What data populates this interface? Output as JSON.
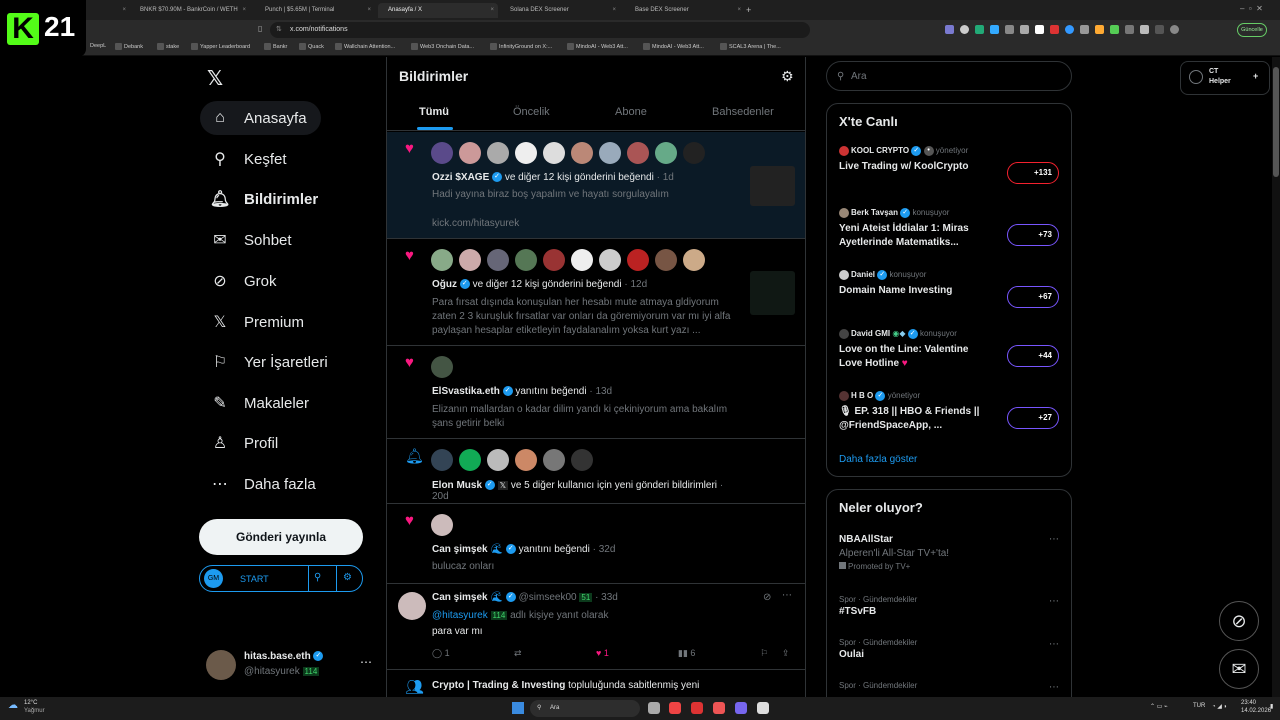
{
  "logo_badge": "21",
  "browser": {
    "tabs": [
      {
        "title": ""
      },
      {
        "title": "BNKR $70.90M - BankrCoin / WETH"
      },
      {
        "title": "Punch | $5.65M | Terminal"
      },
      {
        "title": "Anasayfa / X"
      },
      {
        "title": "Solana DEX Screener"
      },
      {
        "title": "Base DEX Screener"
      }
    ],
    "url": "x.com/notifications",
    "update_label": "Güncelle",
    "bookmarks": [
      "DeepL",
      "Debank",
      "stake",
      "Yapper Leaderboard",
      "Bankr",
      "Quack",
      "Wallchain Attention...",
      "Web3 Onchain Data...",
      "InfinityGround on X:...",
      "MindoAI - Web3 Att...",
      "MindoAI - Web3 Att...",
      "SCAL3 Arena | The..."
    ]
  },
  "sidebar": {
    "items": [
      {
        "label": "Anasayfa",
        "icon": "home-icon"
      },
      {
        "label": "Keşfet",
        "icon": "search-icon"
      },
      {
        "label": "Bildirimler",
        "icon": "bell-icon"
      },
      {
        "label": "Sohbet",
        "icon": "mail-icon"
      },
      {
        "label": "Grok",
        "icon": "grok-icon"
      },
      {
        "label": "Premium",
        "icon": "x-logo-icon"
      },
      {
        "label": "Yer İşaretleri",
        "icon": "bookmark-icon"
      },
      {
        "label": "Makaleler",
        "icon": "article-icon"
      },
      {
        "label": "Profil",
        "icon": "person-icon"
      },
      {
        "label": "Daha fazla",
        "icon": "more-icon"
      }
    ],
    "post_button": "Gönderi yayınla",
    "start_label": "START",
    "account": {
      "name": "hitas.base.eth",
      "handle": "@hitasyurek",
      "badge": "114"
    }
  },
  "main": {
    "title": "Bildirimler",
    "tabs": [
      "Tümü",
      "Öncelik",
      "Abone",
      "Bahsedenler"
    ],
    "notifications": [
      {
        "kind": "like",
        "user": "Ozzi $XAGE",
        "action": "ve diğer 12 kişi gönderini beğendi",
        "time": "1d",
        "body": "Hadi yayına biraz boş yapalım ve hayatı sorgulayalım",
        "link": "kick.com/hitasyurek"
      },
      {
        "kind": "like",
        "user": "Oğuz",
        "action": "ve diğer 12 kişi gönderini beğendi",
        "time": "12d",
        "body": "Para fırsat dışında konuşulan her hesabı mute atmaya gldiyorum zaten 2 3 kuruşluk fırsatlar var onları da göremiyorum var mı iyi alfa paylaşan hesaplar etiketleyin faydalanalım yoksa kurt yazı ..."
      },
      {
        "kind": "like",
        "user": "ElSvastika.eth",
        "action": "yanıtını beğendi",
        "time": "13d",
        "body": "Elizanın mallardan o kadar dilim yandı ki çekiniyorum ama bakalım şans getirir belki"
      },
      {
        "kind": "bell",
        "user": "Elon Musk",
        "action": "ve 5 diğer kullanıcı için yeni gönderi bildirimleri",
        "time": "20d"
      },
      {
        "kind": "like",
        "user": "Can şimşek",
        "action": "yanıtını beğendi",
        "time": "32d",
        "body": "bulucaz onları"
      },
      {
        "kind": "reply",
        "user": "Can şimşek",
        "handle": "@simseek00",
        "badge": "51",
        "time": "33d",
        "mention": "@hitasyurek",
        "mention_badge": "114",
        "mention_suffix": "adlı kişiye yanıt olarak",
        "body": "para var mı",
        "replies": "1",
        "likes": "1",
        "views": "6"
      },
      {
        "kind": "community",
        "user": "Crypto | Trading & Investing",
        "action": "topluluğunda sabitlenmiş yeni"
      }
    ]
  },
  "right": {
    "search_placeholder": "Ara",
    "live_title": "X'te Canlı",
    "live": [
      {
        "host": "KOOL CRYPTO",
        "role": "yönetiyor",
        "title": "Live Trading w/ KoolCrypto",
        "count": "+131"
      },
      {
        "host": "Berk Tavşan",
        "role": "konuşuyor",
        "title": "Yeni Ateist İddialar 1: Miras Ayetlerinde Matematiks...",
        "count": "+73"
      },
      {
        "host": "Daniel",
        "role": "konuşuyor",
        "title": "Domain Name Investing",
        "count": "+67"
      },
      {
        "host": "David GMI",
        "role": "konuşuyor",
        "title": "Love on the Line: Valentine Love Hotline",
        "count": "+44"
      },
      {
        "host": "H B O",
        "role": "yönetiyor",
        "title": "EP. 318 || HBO & Friends || @FriendSpaceApp, ...",
        "count": "+27"
      }
    ],
    "show_more": "Daha fazla göster",
    "trend_title": "Neler oluyor?",
    "trends": [
      {
        "cat": "",
        "name": "NBAAllStar",
        "desc": "Alperen'li All-Star TV+'ta!",
        "promo": "Promoted by TV+"
      },
      {
        "cat": "Spor · Gündemdekiler",
        "name": "#TSvFB"
      },
      {
        "cat": "Spor · Gündemdekiler",
        "name": "Oulai"
      },
      {
        "cat": "Spor · Gündemdekiler",
        "name": ""
      }
    ]
  },
  "ct_helper": {
    "line1": "CT",
    "line2": "Helper"
  },
  "taskbar": {
    "weather_temp": "12°C",
    "weather_desc": "Yağmur",
    "search": "Ara",
    "lang": "TUR",
    "time": "23:40",
    "date": "14.02.2026"
  }
}
